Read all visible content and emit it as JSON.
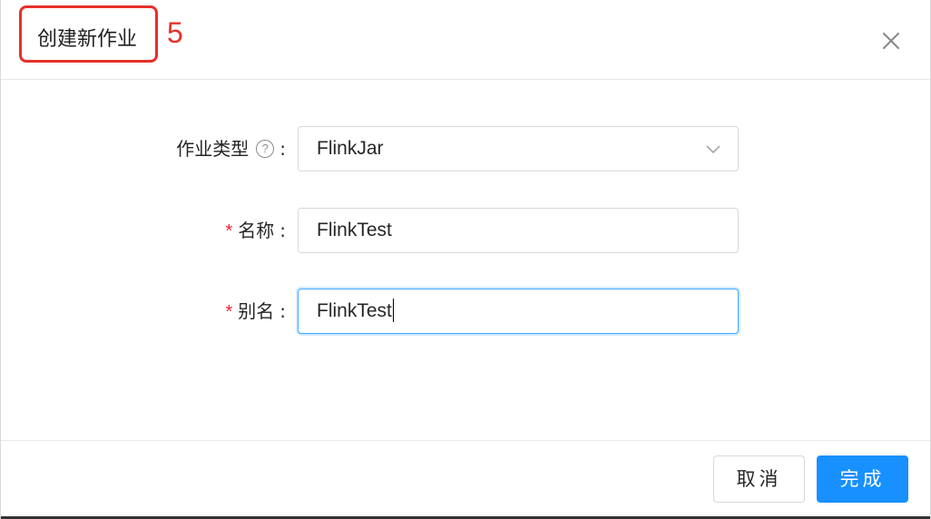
{
  "dialog": {
    "title": "创建新作业",
    "step_number": "5",
    "close_icon": "close-icon"
  },
  "form": {
    "job_type": {
      "label": "作业类型",
      "help_icon": "question-circle-icon",
      "help_glyph": "?",
      "colon": ":",
      "value": "FlinkJar",
      "dropdown_icon": "chevron-down-icon"
    },
    "name": {
      "required_mark": "*",
      "label": "名称",
      "colon": ":",
      "value": "FlinkTest"
    },
    "alias": {
      "required_mark": "*",
      "label": "别名",
      "colon": ":",
      "value": "FlinkTest"
    }
  },
  "footer": {
    "cancel_label": "取消",
    "ok_label": "完成"
  },
  "colors": {
    "primary": "#1890ff",
    "annotation_red": "#e8302a",
    "required_red": "#f5222d",
    "focus_border": "#40a9ff"
  }
}
